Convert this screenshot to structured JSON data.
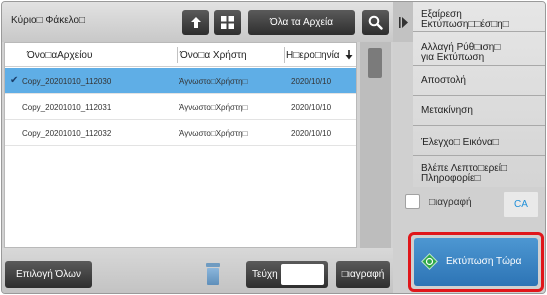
{
  "topbar": {
    "folder_label": "Κύριο□ Φάκελο□",
    "all_files_label": "Όλα τα Αρχεία"
  },
  "list": {
    "headers": {
      "filename": "Όνο□αΑρχείου",
      "username": "Όνο□α Χρήστη",
      "date": "Η□ερο□ηνία"
    },
    "rows": [
      {
        "filename": "Copy_20201010_112030",
        "user": "Άγνωστο□Χρήστη□",
        "date": "2020/10/10",
        "selected": true
      },
      {
        "filename": "Copy_20201010_112031",
        "user": "Άγνωστο□Χρήστη□",
        "date": "2020/10/10",
        "selected": false
      },
      {
        "filename": "Copy_20201010_112032",
        "user": "Άγνωστο□Χρήστη□",
        "date": "2020/10/10",
        "selected": false
      }
    ]
  },
  "bottombar": {
    "select_all_label": "Επιλογή Όλων",
    "copies_label": "Τεύχη",
    "copies_value": "",
    "delete_label": "□ιαγραφή"
  },
  "menu": {
    "items": [
      {
        "line1": "Εξαίρεση",
        "line2": "Εκτύπωση□□έσ□η□"
      },
      {
        "line1": "Αλλαγή Ρύθ□ιση□",
        "line2": "για Εκτύπωση"
      },
      {
        "line1": "Αποστολή",
        "line2": ""
      },
      {
        "line1": "Μετακίνηση",
        "line2": ""
      },
      {
        "line1": "Έλεγχο□ Εικόνα□",
        "line2": ""
      },
      {
        "line1": "Βλέπε Λεπτο□ερεί□",
        "line2": "Πληροφορίε□"
      }
    ]
  },
  "delete_option": {
    "label": "□ιαγραφή",
    "checked": false,
    "ca_label": "CA"
  },
  "print": {
    "label": "Εκτύπωση Τώρα"
  },
  "colors": {
    "selected_row": "#5faee6",
    "print_button": "#3a84c4",
    "highlight_border": "#e0161a",
    "ca_text": "#1f8fd8"
  }
}
